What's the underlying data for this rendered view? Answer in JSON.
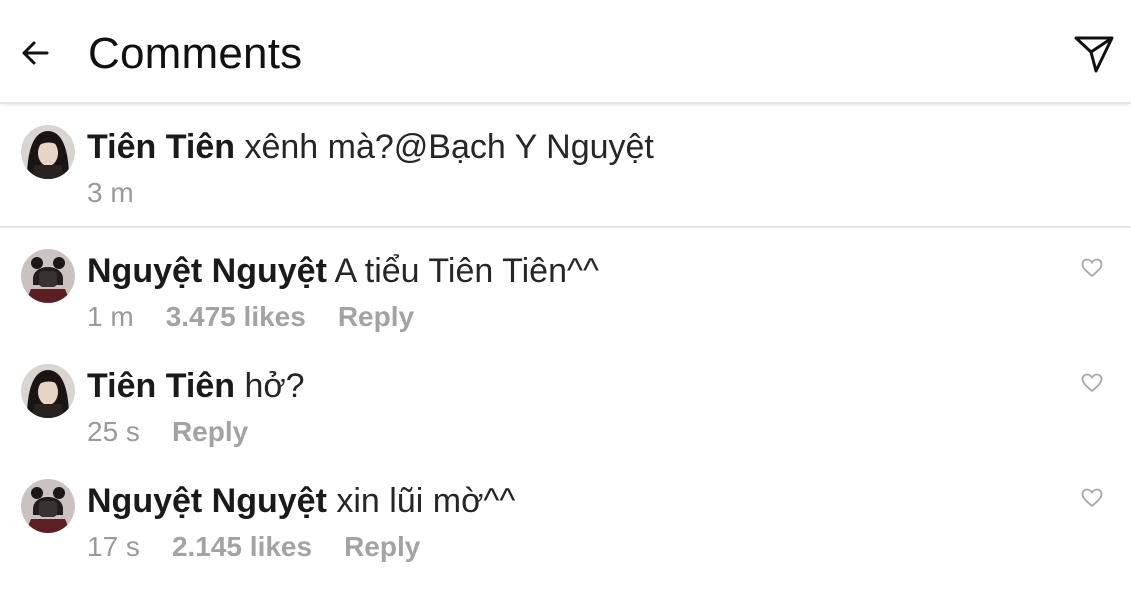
{
  "header": {
    "title": "Comments",
    "back_icon": "arrow-left-icon",
    "send_icon": "paper-plane-icon"
  },
  "caption": {
    "username": "Tiên Tiên",
    "text": "xênh mà?@Bạch Y Nguyệt",
    "time": "3 m"
  },
  "comments": [
    {
      "username": "Nguyệt Nguyệt",
      "text": "A tiểu Tiên Tiên^^",
      "time": "1 m",
      "likes": "3.475 likes",
      "reply": "Reply"
    },
    {
      "username": "Tiên Tiên",
      "text": "hở?",
      "time": "25 s",
      "reply": "Reply"
    },
    {
      "username": "Nguyệt Nguyệt",
      "text": "xin lũi mờ^^",
      "time": "17 s",
      "likes": "2.145 likes",
      "reply": "Reply"
    }
  ],
  "colors": {
    "text": "#262626",
    "meta": "#9a9a9a",
    "divider": "#e6e6e6"
  }
}
